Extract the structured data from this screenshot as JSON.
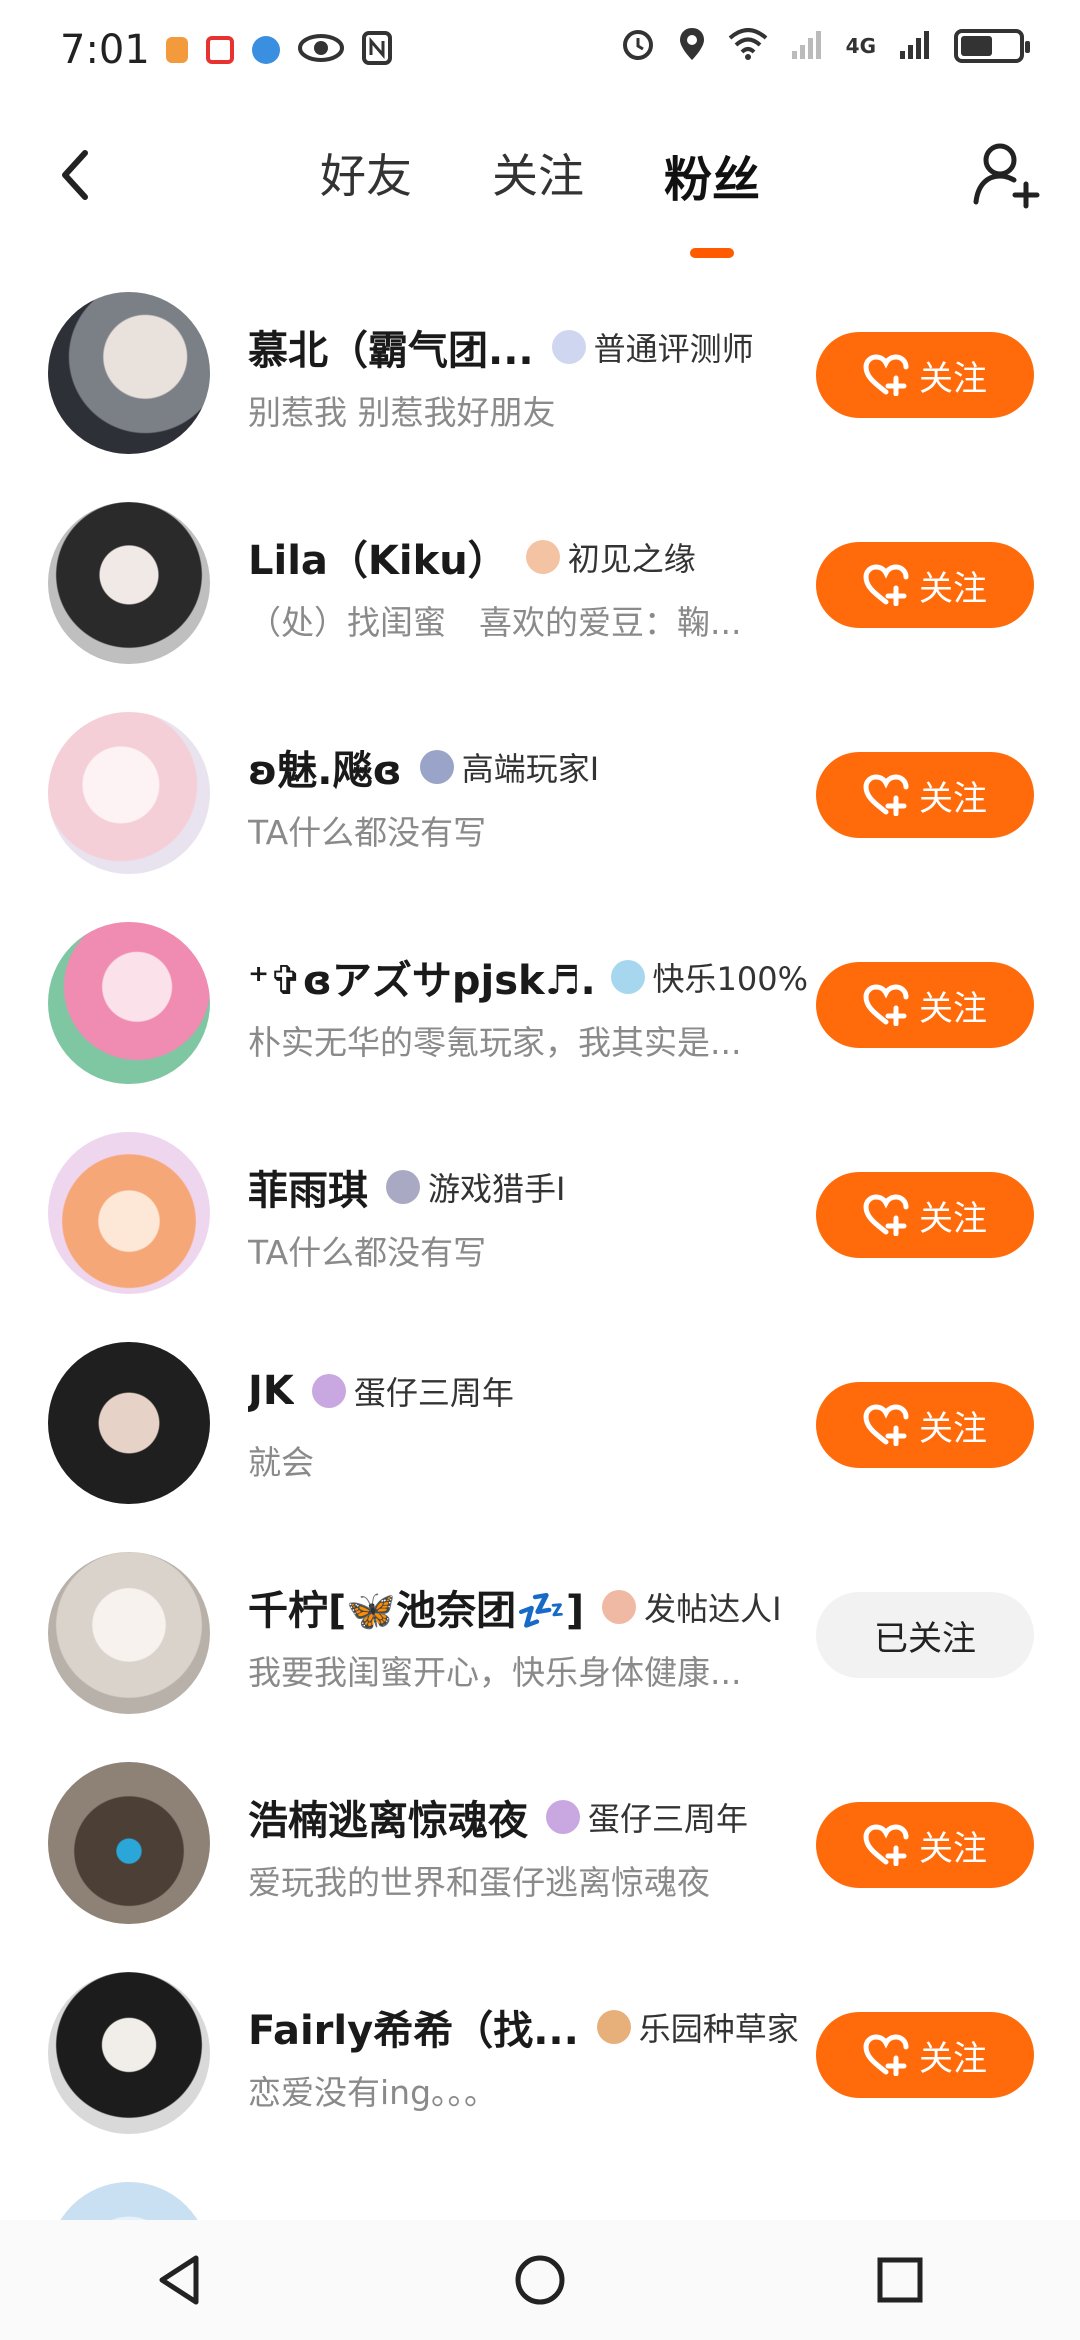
{
  "status_bar": {
    "time": "7:01",
    "network": "4G",
    "battery_level": 0.55,
    "left_icons": [
      "notification-icon",
      "app-icon",
      "browser-icon",
      "eye-icon",
      "nfc-icon"
    ],
    "right_icons": [
      "alarm-icon",
      "location-icon",
      "wifi-icon",
      "signal-icon",
      "battery-icon"
    ]
  },
  "header": {
    "tabs": [
      {
        "label": "好友"
      },
      {
        "label": "关注"
      },
      {
        "label": "粉丝"
      }
    ],
    "active_tab": 2
  },
  "follow_label": "关注",
  "followed_label": "已关注",
  "accent_color": "#ff6a0a",
  "users": [
    {
      "name": "慕北（霸气团...",
      "badge": "普通评测师",
      "bio": "别惹我 别惹我好朋友",
      "followed": false
    },
    {
      "name": "Lila（Kiku）",
      "badge": "初见之缘",
      "bio": "（处）找闺蜜　喜欢的爱豆：鞠...",
      "followed": false
    },
    {
      "name": "ʚ魅.飚ɞ",
      "badge": "高端玩家Ⅰ",
      "bio": "TA什么都没有写",
      "followed": false
    },
    {
      "name": "⁺✞ɞアズサpjsk♬...",
      "badge": "快乐100%",
      "bio": "朴实无华的零氪玩家，我其实是...",
      "followed": false
    },
    {
      "name": "菲雨琪",
      "badge": "游戏猎手Ⅰ",
      "bio": "TA什么都没有写",
      "followed": false
    },
    {
      "name": "JK",
      "badge": "蛋仔三周年",
      "bio": "就会",
      "followed": false
    },
    {
      "name": "千柠[🦋池奈团💤]",
      "badge": "发帖达人Ⅰ",
      "bio": "我要我闺蜜开心，快乐身体健康...",
      "followed": true
    },
    {
      "name": "浩楠逃离惊魂夜",
      "badge": "蛋仔三周年",
      "bio": "爱玩我的世界和蛋仔逃离惊魂夜",
      "followed": false
    },
    {
      "name": "Fairly希希（找...",
      "badge": "乐园种草家",
      "bio": "恋爱没有ing。。。",
      "followed": false
    }
  ]
}
